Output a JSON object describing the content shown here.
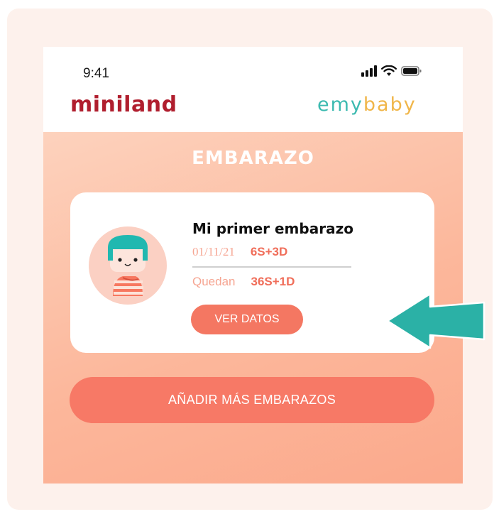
{
  "status_bar": {
    "time": "9:41",
    "icons": [
      "signal-icon",
      "wifi-icon",
      "battery-icon"
    ]
  },
  "header": {
    "brand_left": "miniland",
    "brand_right_part1": "emy",
    "brand_right_part2": "baby"
  },
  "screen": {
    "title": "EMBARAZO"
  },
  "pregnancy_card": {
    "title": "Mi primer embarazo",
    "date": "01/11/21",
    "current_week": "6S+3D",
    "remaining_label": "Quedan",
    "remaining_value": "36S+1D",
    "button_label": "VER DATOS",
    "avatar_icon": "pregnant-woman-avatar-icon"
  },
  "actions": {
    "add_more_label": "AÑADIR MÁS EMBARAZOS"
  },
  "colors": {
    "brand_red": "#b01e2e",
    "teal": "#3cbab0",
    "yellow": "#f0b64a",
    "coral": "#f47762",
    "arrow": "#2bb1a6"
  }
}
